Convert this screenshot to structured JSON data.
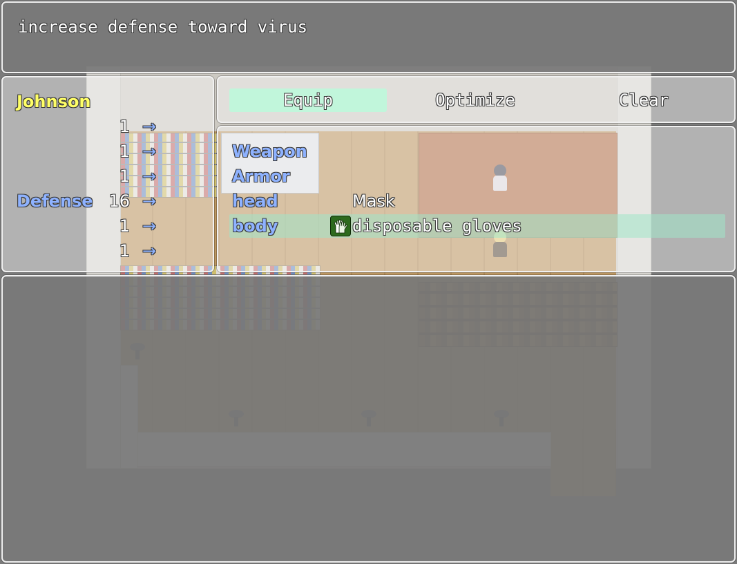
{
  "help": {
    "text": "increase defense toward virus"
  },
  "actor": {
    "name": "Johnson",
    "param_label": "Defense",
    "param_values": [
      "1",
      "1",
      "1",
      "16",
      "1",
      "1"
    ],
    "arrow": "→"
  },
  "commands": {
    "equip": "Equip",
    "optimize": "Optimize",
    "clear": "Clear",
    "selected": "Equip"
  },
  "slots": [
    {
      "type": "Weapon",
      "item": ""
    },
    {
      "type": "Armor",
      "item": ""
    },
    {
      "type": "head",
      "item": "Mask"
    },
    {
      "type": "body",
      "item": "disposable gloves",
      "icon": "gloves-icon"
    }
  ],
  "colors": {
    "system_blue": "#8eb2ff",
    "actor_name": "#ffff66",
    "highlight": "#a0e6c8"
  }
}
